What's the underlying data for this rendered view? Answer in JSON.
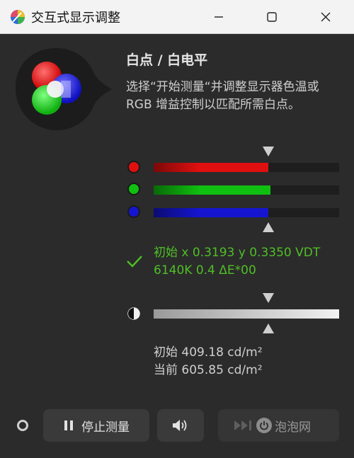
{
  "window": {
    "title": "交互式显示调整",
    "icon": "color-wheel-icon",
    "controls": [
      "minimize-icon",
      "maximize-icon",
      "close-icon"
    ]
  },
  "section": {
    "heading": "白点 / 白电平",
    "description_lines": [
      "选择“开始测量“并调整显示器色温或",
      "RGB 增益控制以匹配所需白点。"
    ]
  },
  "rgb_channels": [
    {
      "name": "red",
      "color": "#e01010",
      "level": 0.62
    },
    {
      "name": "green",
      "color": "#10c010",
      "level": 0.63
    },
    {
      "name": "blue",
      "color": "#1515d0",
      "level": 0.62
    }
  ],
  "target_marker_rgb": 0.62,
  "measurement": {
    "line1": "初始 x 0.3193 y 0.3350 VDT",
    "line2": "6140K 0.4 ΔE*00"
  },
  "luminance": {
    "target_marker": 0.62,
    "initial": "初始 409.18 cd/m²",
    "current": "当前 605.85 cd/m²"
  },
  "footer": {
    "stop_label": "停止测量",
    "watermark": "泡泡网"
  },
  "colors": {
    "status_green": "#4fbf26",
    "background": "#2b2b2b"
  }
}
